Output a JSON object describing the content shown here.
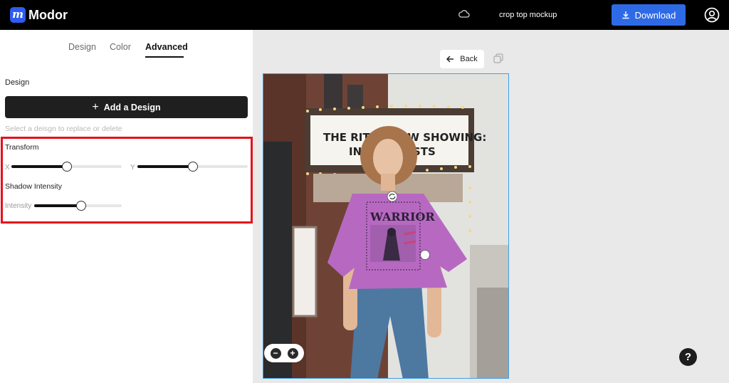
{
  "app": {
    "brand": "Modor",
    "logo_letter": "m",
    "document_title": "crop top mockup",
    "download_label": "Download",
    "accent_color": "#2f6ae6"
  },
  "tabs": [
    {
      "label": "Design",
      "active": false
    },
    {
      "label": "Color",
      "active": false
    },
    {
      "label": "Advanced",
      "active": true
    }
  ],
  "design_section": {
    "label": "Design",
    "add_button_label": "Add a Design",
    "hint": "Select a deisgn to replace or delete"
  },
  "transform": {
    "label": "Transform",
    "x_label": "X",
    "y_label": "Y",
    "x_value_percent": 50,
    "y_value_percent": 50
  },
  "shadow": {
    "label": "Shadow Intensity",
    "intensity_label": "Intensity",
    "intensity_value_percent": 54
  },
  "canvas": {
    "back_label": "Back",
    "zoom_out_symbol": "−",
    "zoom_in_symbol": "+"
  },
  "mockup_print": {
    "headline": "WARRIOR",
    "sign_line1": "THE RITZ - NOW SHOWING:",
    "sign_line2": "INDIE ARTISTS"
  },
  "help_symbol": "?",
  "icons": [
    "cloud-icon",
    "download-icon",
    "account-icon",
    "plus-icon",
    "back-arrow-icon",
    "copy-icon",
    "zoom-out-icon",
    "zoom-in-icon",
    "help-icon",
    "rotate-handle-icon"
  ],
  "highlight_color": "#e3121b"
}
